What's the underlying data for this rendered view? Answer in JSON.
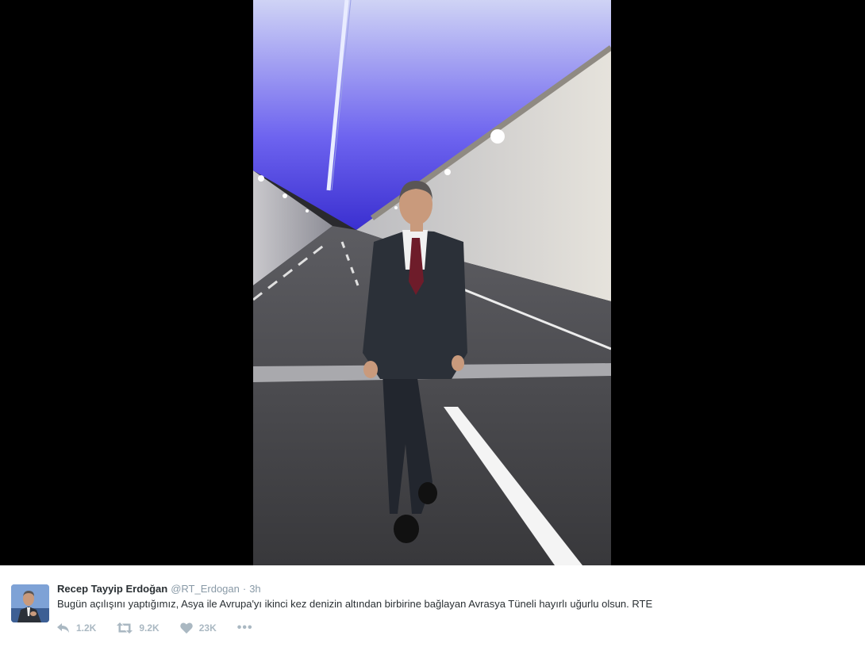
{
  "media": {
    "photo_icon": "tunnel-photo"
  },
  "tweet": {
    "display_name": "Recep Tayyip Erdoğan",
    "handle": "@RT_Erdogan",
    "separator": "·",
    "time": "3h",
    "text": "Bugün açılışını yaptığımız, Asya ile Avrupa'yı ikinci kez denizin altından birbirine bağlayan Avrasya Tüneli hayırlı uğurlu olsun. RTE",
    "actions": {
      "reply_count": "1.2K",
      "retweet_count": "9.2K",
      "like_count": "23K",
      "more_label": "•••"
    }
  },
  "colors": {
    "action_icon": "#aab8c2",
    "name": "#292f33",
    "meta": "#8899a6",
    "tunnel_light": "#6b5cff"
  }
}
